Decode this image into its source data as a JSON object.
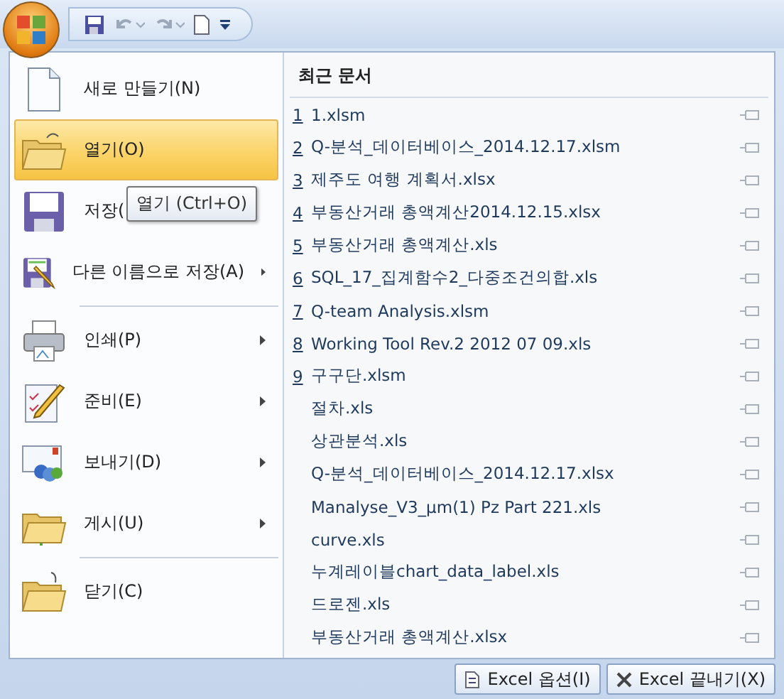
{
  "quick_access": {
    "buttons": [
      {
        "kind": "save"
      },
      {
        "kind": "undo"
      },
      {
        "kind": "redo"
      },
      {
        "kind": "new"
      },
      {
        "kind": "customize"
      }
    ]
  },
  "menu": {
    "items": [
      {
        "label": "새로 만들기(N)",
        "kind": "new",
        "submenu": false,
        "selected": false,
        "divider_after": false
      },
      {
        "label": "열기(O)",
        "kind": "open",
        "submenu": false,
        "selected": true,
        "divider_after": false
      },
      {
        "label": "저장(",
        "kind": "save",
        "submenu": false,
        "selected": false,
        "divider_after": false
      },
      {
        "label": "다른 이름으로 저장(A)",
        "kind": "saveas",
        "submenu": true,
        "selected": false,
        "divider_after": true
      },
      {
        "label": "인쇄(P)",
        "kind": "print",
        "submenu": true,
        "selected": false,
        "divider_after": false
      },
      {
        "label": "준비(E)",
        "kind": "prepare",
        "submenu": true,
        "selected": false,
        "divider_after": false
      },
      {
        "label": "보내기(D)",
        "kind": "send",
        "submenu": true,
        "selected": false,
        "divider_after": false
      },
      {
        "label": "게시(U)",
        "kind": "publish",
        "submenu": true,
        "selected": false,
        "divider_after": true
      },
      {
        "label": "닫기(C)",
        "kind": "close",
        "submenu": false,
        "selected": false,
        "divider_after": false
      }
    ]
  },
  "tooltip": "열기 (Ctrl+O)",
  "recent": {
    "title": "최근 문서",
    "files": [
      {
        "number": "1",
        "name": "1.xlsm"
      },
      {
        "number": "2",
        "name": "Q-분석_데이터베이스_2014.12.17.xlsm"
      },
      {
        "number": "3",
        "name": "제주도 여행 계획서.xlsx"
      },
      {
        "number": "4",
        "name": "부동산거래 총액계산2014.12.15.xlsx"
      },
      {
        "number": "5",
        "name": "부동산거래 총액계산.xls"
      },
      {
        "number": "6",
        "name": "SQL_17_집계함수2_다중조건의합.xls"
      },
      {
        "number": "7",
        "name": "Q-team Analysis.xlsm"
      },
      {
        "number": "8",
        "name": "Working Tool Rev.2 2012 07 09.xls"
      },
      {
        "number": "9",
        "name": "구구단.xlsm"
      },
      {
        "name": "절차.xls"
      },
      {
        "name": "상관분석.xls"
      },
      {
        "name": "Q-분석_데이터베이스_2014.12.17.xlsx"
      },
      {
        "name": "Manalyse_V3_µm(1) Pz Part 221.xls"
      },
      {
        "name": "curve.xls"
      },
      {
        "name": "누계레이블chart_data_label.xls"
      },
      {
        "name": "드로젠.xls"
      },
      {
        "name": "부동산거래 총액계산.xlsx"
      }
    ]
  },
  "footer": {
    "buttons": [
      {
        "label": "Excel 옵션(I)",
        "kind": "options"
      },
      {
        "label": "Excel 끝내기(X)",
        "kind": "exit"
      }
    ]
  }
}
